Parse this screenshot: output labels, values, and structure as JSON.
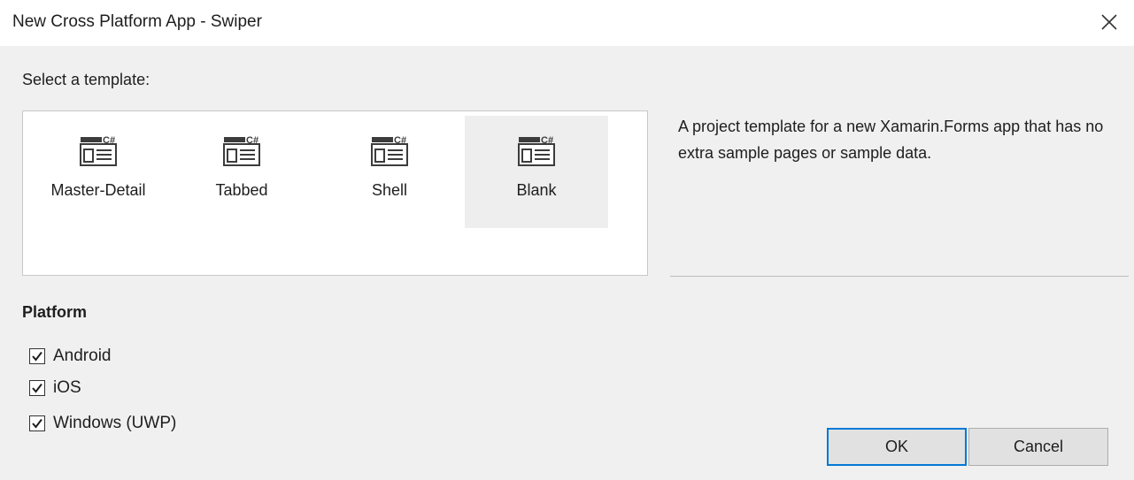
{
  "window": {
    "title": "New Cross Platform App - Swiper",
    "close_icon": "close-icon"
  },
  "template_section": {
    "label": "Select a template:",
    "templates": [
      {
        "label": "Master-Detail",
        "icon": "csharp-template-icon",
        "selected": false
      },
      {
        "label": "Tabbed",
        "icon": "csharp-template-icon",
        "selected": false
      },
      {
        "label": "Shell",
        "icon": "csharp-template-icon",
        "selected": false
      },
      {
        "label": "Blank",
        "icon": "csharp-template-icon",
        "selected": true
      }
    ],
    "description": "A project template for a new Xamarin.Forms app that has no extra sample pages or sample data."
  },
  "platform": {
    "heading": "Platform",
    "options": [
      {
        "label": "Android",
        "checked": true
      },
      {
        "label": "iOS",
        "checked": true
      },
      {
        "label": "Windows (UWP)",
        "checked": true
      }
    ]
  },
  "buttons": {
    "ok": "OK",
    "cancel": "Cancel"
  },
  "colors": {
    "background": "#f0f0f0",
    "accent": "#0078d7",
    "selected_tile": "#eeeeee"
  }
}
